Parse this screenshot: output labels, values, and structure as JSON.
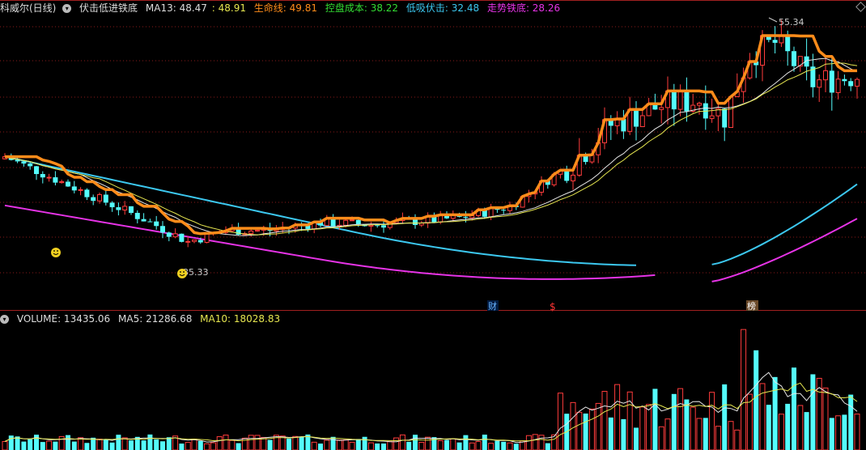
{
  "header": {
    "stock_label": "科威尔(日线)",
    "indicator_name": "伏击低进铁底",
    "ma13_label": "MA13: 48.47",
    "ma13_second": ": 48.91",
    "life_line": "生命线: 49.81",
    "control_cost": "控盘成本: 38.22",
    "low_ambush": "低吸伏击: 32.48",
    "trend_bottom": "走势铁底: 28.26",
    "collapse_icon": "chevron-down-icon"
  },
  "volume_header": {
    "volume": "VOLUME: 13435.06",
    "ma5": "MA5: 21286.68",
    "ma10": "MA10: 18028.83"
  },
  "markers": {
    "high_label": "55.34",
    "low_label": "35.33",
    "event_cai": "财",
    "event_dollar": "$",
    "event_bang": "榜"
  },
  "colors": {
    "up": "#ff3c3c",
    "down": "#54fcfc",
    "orange": "#ff8c1a",
    "green": "#33cc33",
    "cyan": "#3cc8f0",
    "magenta": "#e633e6",
    "white": "#e6e6e6",
    "yellow": "#e6e650",
    "grid": "#8a1a1a"
  },
  "chart_data": {
    "type": "candlestick+volume",
    "price_range": [
      31.5,
      57.5
    ],
    "volume_range": [
      0,
      60000
    ],
    "series_names": [
      "MA13",
      "生命线",
      "控盘成本",
      "低吸伏击",
      "走势铁底"
    ]
  }
}
